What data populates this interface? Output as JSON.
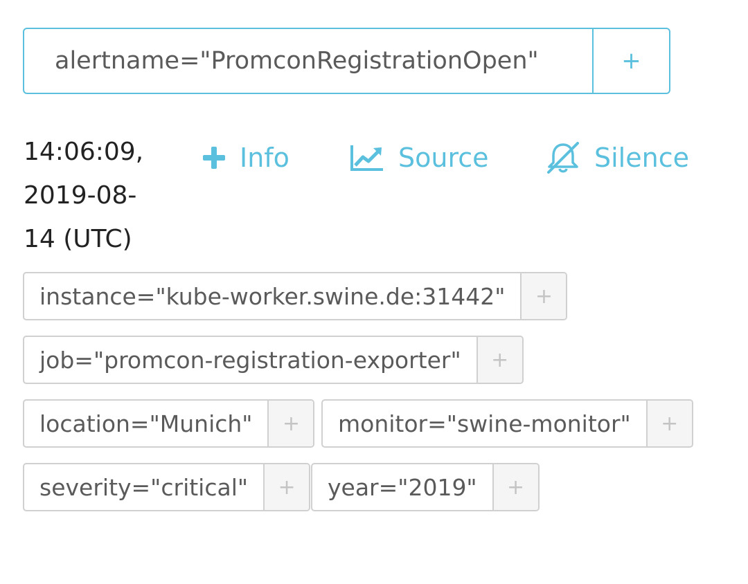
{
  "alert": {
    "name_label": "alertname=\"PromconRegistrationOpen\"",
    "add_symbol": "+"
  },
  "timestamp": "14:06:09, 2019-08-14 (UTC)",
  "actions": {
    "info": "Info",
    "source": "Source",
    "silence": "Silence"
  },
  "labels": [
    {
      "text": "instance=\"kube-worker.swine.de:31442\"",
      "add": "+"
    },
    {
      "text": "job=\"promcon-registration-exporter\"",
      "add": "+"
    },
    {
      "text": "location=\"Munich\"",
      "add": "+"
    },
    {
      "text": "monitor=\"swine-monitor\"",
      "add": "+"
    },
    {
      "text": "severity=\"critical\"",
      "add": "+"
    },
    {
      "text": "year=\"2019\"",
      "add": "+"
    }
  ],
  "colors": {
    "accent": "#5bc0de",
    "chip_border": "#d0d0d0",
    "text": "#5a5a5a",
    "timestamp": "#222222"
  },
  "icons": {
    "info": "plus-icon",
    "source": "chart-line-icon",
    "silence": "bell-slash-icon"
  }
}
